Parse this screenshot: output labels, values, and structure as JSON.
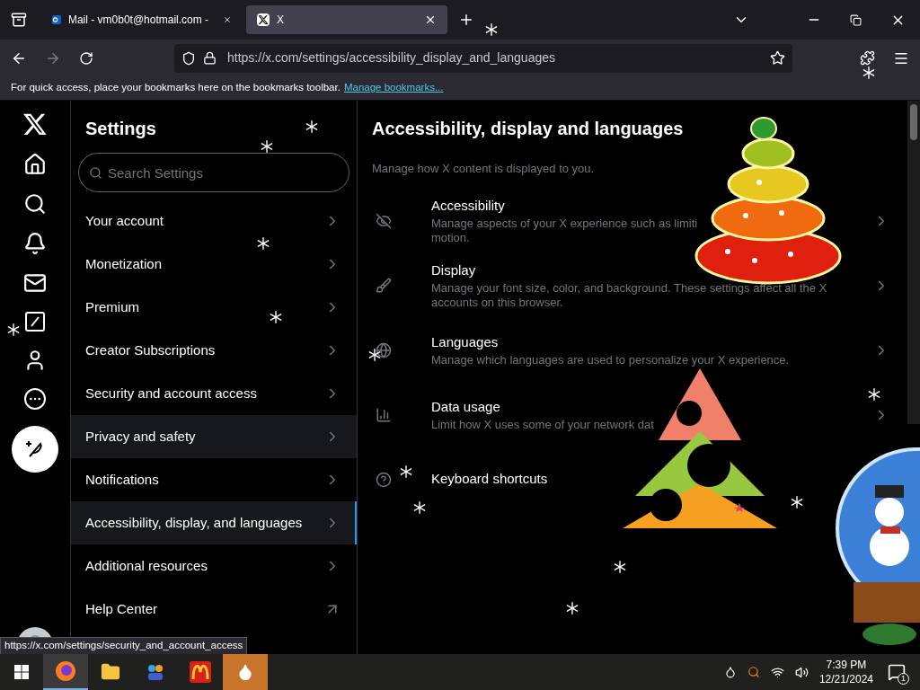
{
  "browser": {
    "tabs": [
      {
        "title": "Mail - vm0b0t@hotmail.com -",
        "kind": "mail",
        "selected": false
      },
      {
        "title": "X",
        "kind": "x",
        "selected": true
      }
    ],
    "url": "https://x.com/settings/accessibility_display_and_languages",
    "bookmarks_bar": {
      "text": "For quick access, place your bookmarks here on the bookmarks toolbar.",
      "link": "Manage bookmarks..."
    }
  },
  "settings": {
    "title": "Settings",
    "search_placeholder": "Search Settings",
    "items": [
      {
        "label": "Your account",
        "kind": "chevron",
        "selected": false,
        "hovered": false
      },
      {
        "label": "Monetization",
        "kind": "chevron",
        "selected": false,
        "hovered": false
      },
      {
        "label": "Premium",
        "kind": "chevron",
        "selected": false,
        "hovered": false
      },
      {
        "label": "Creator Subscriptions",
        "kind": "chevron",
        "selected": false,
        "hovered": false
      },
      {
        "label": "Security and account access",
        "kind": "chevron",
        "selected": false,
        "hovered": false
      },
      {
        "label": "Privacy and safety",
        "kind": "chevron",
        "selected": false,
        "hovered": true
      },
      {
        "label": "Notifications",
        "kind": "chevron",
        "selected": false,
        "hovered": false
      },
      {
        "label": "Accessibility, display, and languages",
        "kind": "chevron",
        "selected": true,
        "hovered": false
      },
      {
        "label": "Additional resources",
        "kind": "chevron",
        "selected": false,
        "hovered": false
      },
      {
        "label": "Help Center",
        "kind": "external",
        "selected": false,
        "hovered": false
      }
    ]
  },
  "content": {
    "title": "Accessibility, display and languages",
    "subtitle": "Manage how X content is displayed to you.",
    "items": [
      {
        "title": "Accessibility",
        "lines": [
          "Manage aspects of your X experience such as limiti",
          "motion."
        ],
        "chevron": true
      },
      {
        "title": "Display",
        "lines": [
          "Manage your font size, color, and background. These settings affect all the X",
          "accounts on this browser."
        ],
        "chevron": true
      },
      {
        "title": "Languages",
        "lines": [
          "Manage which languages are used to personalize your X experience."
        ],
        "chevron": true
      },
      {
        "title": "Data usage",
        "lines": [
          "Limit how X uses some of your network dat"
        ],
        "chevron": true
      },
      {
        "title": "Keyboard shortcuts",
        "chevron": false
      }
    ]
  },
  "status_link": "https://x.com/settings/security_and_account_access",
  "taskbar": {
    "time": "7:39 PM",
    "date": "12/21/2024",
    "notification_count": "1"
  }
}
